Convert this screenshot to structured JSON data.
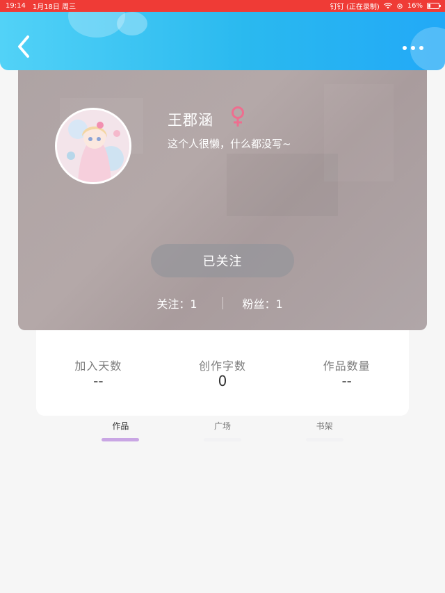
{
  "status_bar": {
    "time": "19:14",
    "date": "1月18日 周三",
    "app_status": "钉钉 (正在录制)",
    "battery": "16%"
  },
  "header": {
    "back_icon": "chevron-left-icon",
    "more_icon": "more-dots-icon"
  },
  "profile": {
    "name": "王郡涵",
    "gender_icon": "female-icon",
    "gender_color": "#ee6e8f",
    "bio": "这个人很懒，什么都没写~",
    "follow_button": "已关注",
    "following": "关注：1",
    "fans": "粉丝：1"
  },
  "stats": [
    {
      "label": "加入天数",
      "value": "--"
    },
    {
      "label": "创作字数",
      "value": "0"
    },
    {
      "label": "作品数量",
      "value": "--"
    }
  ],
  "tabs": [
    {
      "label": "作品",
      "active": true
    },
    {
      "label": "广场",
      "active": false
    },
    {
      "label": "书架",
      "active": false
    }
  ],
  "colors": {
    "status_bar": "#ef3b36",
    "header_start": "#52d2f7",
    "header_end": "#22a9f7",
    "tab_indicator_active": "#c9a6e4"
  }
}
